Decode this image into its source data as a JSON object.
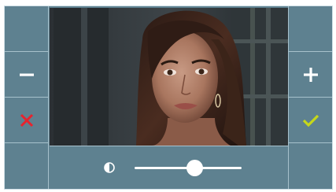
{
  "display": {
    "background_color": "#5e8190",
    "divider_color": "#a7c1cc"
  },
  "left_buttons": [
    {
      "name": "blank",
      "icon": ""
    },
    {
      "name": "volume-down",
      "icon": "minus-icon",
      "color": "#ffffff"
    },
    {
      "name": "cancel",
      "icon": "close-icon",
      "color": "#e8232d"
    },
    {
      "name": "blank",
      "icon": ""
    }
  ],
  "right_buttons": [
    {
      "name": "blank",
      "icon": ""
    },
    {
      "name": "volume-up",
      "icon": "plus-icon",
      "color": "#ffffff"
    },
    {
      "name": "confirm",
      "icon": "check-icon",
      "color": "#c6d81a"
    },
    {
      "name": "blank",
      "icon": ""
    }
  ],
  "video_feed": {
    "content": "camera-image"
  },
  "contrast_control": {
    "icon": "contrast-icon",
    "level": 0.56
  }
}
